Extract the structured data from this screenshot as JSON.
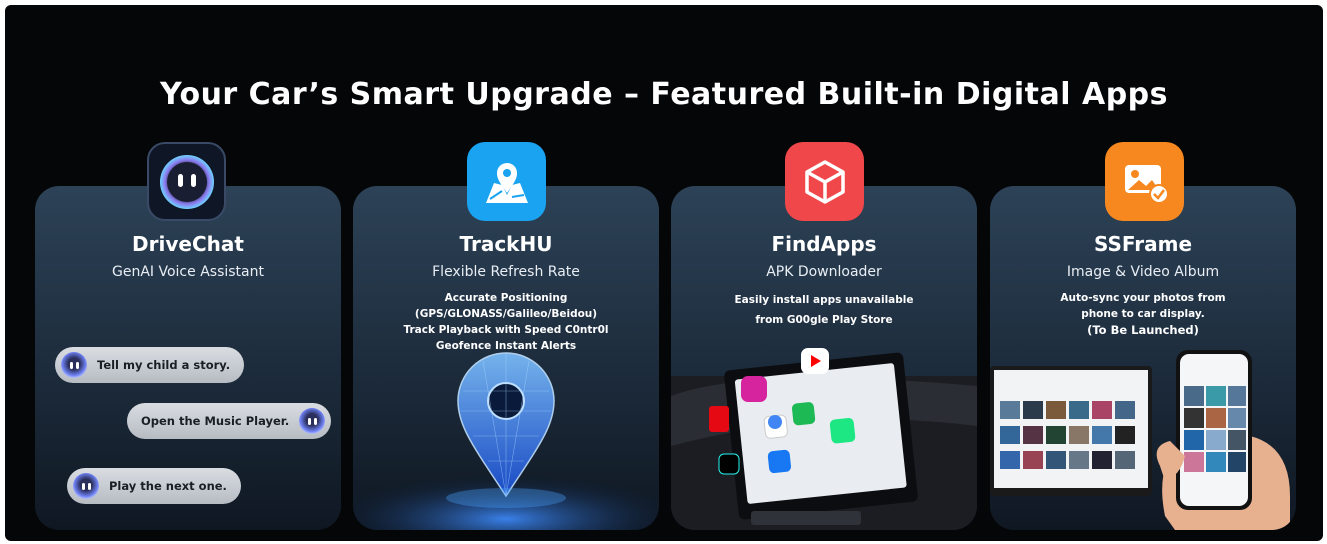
{
  "headline": "Your Car’s Smart Upgrade – Featured Built-in Digital Apps",
  "cards": [
    {
      "title": "DriveChat",
      "subtitle": "GenAI Voice Assistant",
      "bubbles": [
        "Tell my child a story.",
        "Open the Music Player.",
        "Play the next one."
      ]
    },
    {
      "title": "TrackHU",
      "subtitle": "Flexible Refresh Rate",
      "desc": [
        "Accurate Positioning (GPS/GLONASS/Galileo/Beidou)",
        "Track Playback with Speed C0ntr0l",
        "Geofence Instant Alerts"
      ]
    },
    {
      "title": "FindApps",
      "subtitle": "APK Downloader",
      "desc": [
        "Easily install apps unavailable",
        "from G00gle Play Store"
      ]
    },
    {
      "title": "SSFrame",
      "subtitle": "Image & Video Album",
      "desc": [
        "Auto-sync your photos from",
        "phone to car display.",
        "(To Be Launched)"
      ]
    }
  ],
  "colors": {
    "background": "#050608",
    "card_top": "#2d4257",
    "trackhu_icon": "#1aa3f0",
    "findapps_icon": "#f0484a",
    "ssframe_icon": "#f6881f"
  }
}
